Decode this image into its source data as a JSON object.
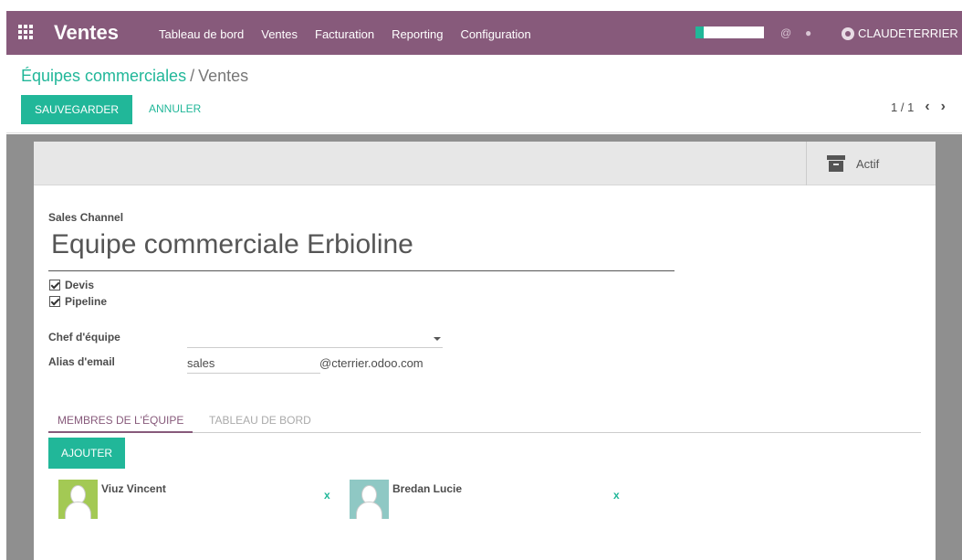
{
  "navbar": {
    "app_name": "Ventes",
    "menu": [
      "Tableau de bord",
      "Ventes",
      "Facturation",
      "Reporting",
      "Configuration"
    ],
    "progress": 0.12,
    "progress_color": "#21b799",
    "user": "CLAUDETERRIER",
    "icons": [
      "apps-grid-icon",
      "at-sign-icon",
      "chat-icon",
      "user-avatar-icon"
    ],
    "color": "#875a7b"
  },
  "breadcrumb": {
    "parent": "Équipes commerciales",
    "separator": "/",
    "current": "Ventes"
  },
  "toolbar": {
    "save_label": "SAUVEGARDER",
    "cancel_label": "ANNULER",
    "pager": "1 / 1"
  },
  "form": {
    "actif_label": "Actif",
    "channel_label": "Sales Channel",
    "name": "Equipe commerciale Erbioline",
    "checkboxes": [
      {
        "label": "Devis",
        "checked": true
      },
      {
        "label": "Pipeline",
        "checked": true
      }
    ],
    "leader_label": "Chef d'équipe",
    "leader_value": "",
    "alias_label": "Alias d'email",
    "alias_value": "sales",
    "alias_domain": "@cterrier.odoo.com"
  },
  "tabs": [
    "MEMBRES DE L'ÉQUIPE",
    "TABLEAU DE BORD"
  ],
  "members": {
    "add_label": "AJOUTER",
    "remove_label": "x",
    "items": [
      {
        "name": "Viuz Vincent",
        "avatar_color": "#a3c954"
      },
      {
        "name": "Bredan Lucie",
        "avatar_color": "#8fc8c4"
      }
    ]
  },
  "accent_color": "#21b799"
}
